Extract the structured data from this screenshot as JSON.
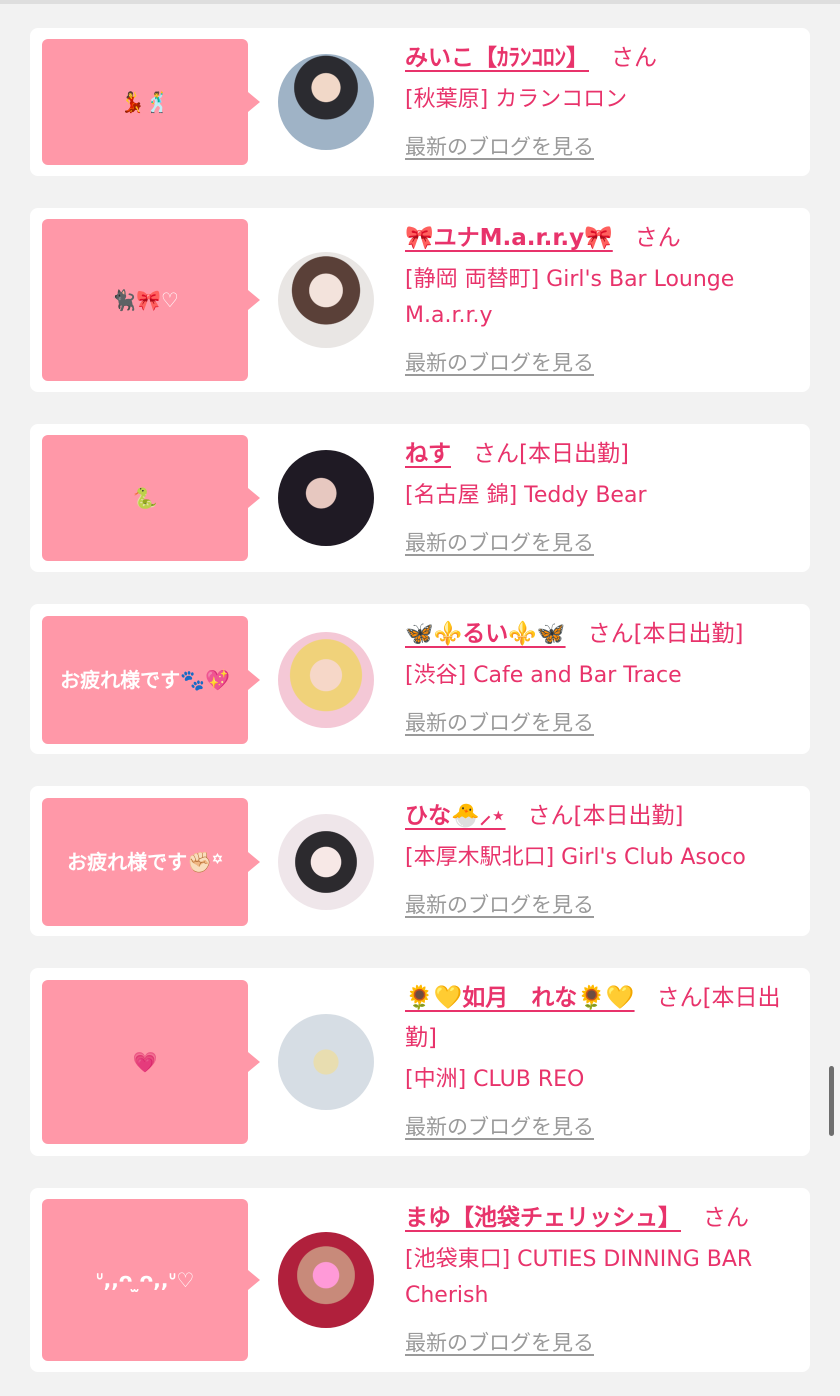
{
  "colors": {
    "accent": "#e8336b",
    "bubble": "#ff98a8",
    "link_gray": "#9a9a9a"
  },
  "entries": [
    {
      "bubble": "💃🕺",
      "name": "みいこ【ｶﾗﾝｺﾛﾝ】",
      "san": "さん",
      "store": "[秋葉原] カランコロン",
      "blog": "最新のブログを見る"
    },
    {
      "bubble": "🐈‍⬛🎀♡",
      "name": "🎀ユナM.a.r.r.y🎀",
      "san": "さん",
      "store": "[静岡 両替町] Girl's Bar Lounge M.a.r.r.y",
      "blog": "最新のブログを見る"
    },
    {
      "bubble": "🐍",
      "name": "ねす",
      "san": "さん[本日出勤]",
      "store": "[名古屋 錦] Teddy Bear",
      "blog": "最新のブログを見る"
    },
    {
      "bubble": "お疲れ様です🐾💖",
      "name": "🦋⚜️るい⚜️🦋",
      "san": "さん[本日出勤]",
      "store": "[渋谷] Cafe and Bar Trace",
      "blog": "最新のブログを見る"
    },
    {
      "bubble": "お疲れ様です✊🏻꙳",
      "name": "ひな🐣⸝⋆",
      "san": "さん[本日出勤]",
      "store": "[本厚木駅北口] Girl's Club Asoco",
      "blog": "最新のブログを見る"
    },
    {
      "bubble": "💗",
      "name": "🌻💛如月　れな🌻💛",
      "san": "さん[本日出勤]",
      "store": "[中洲] CLUB REO",
      "blog": "最新のブログを見る"
    },
    {
      "bubble": "ᐡ,,ᴖ‌ ̫ᴖ‌,,ᐡ♡",
      "name": "まゆ【池袋チェリッシュ】",
      "san": "さん",
      "store": "[池袋東口] CUTIES DINNING BAR Cherish",
      "blog": "最新のブログを見る"
    }
  ]
}
